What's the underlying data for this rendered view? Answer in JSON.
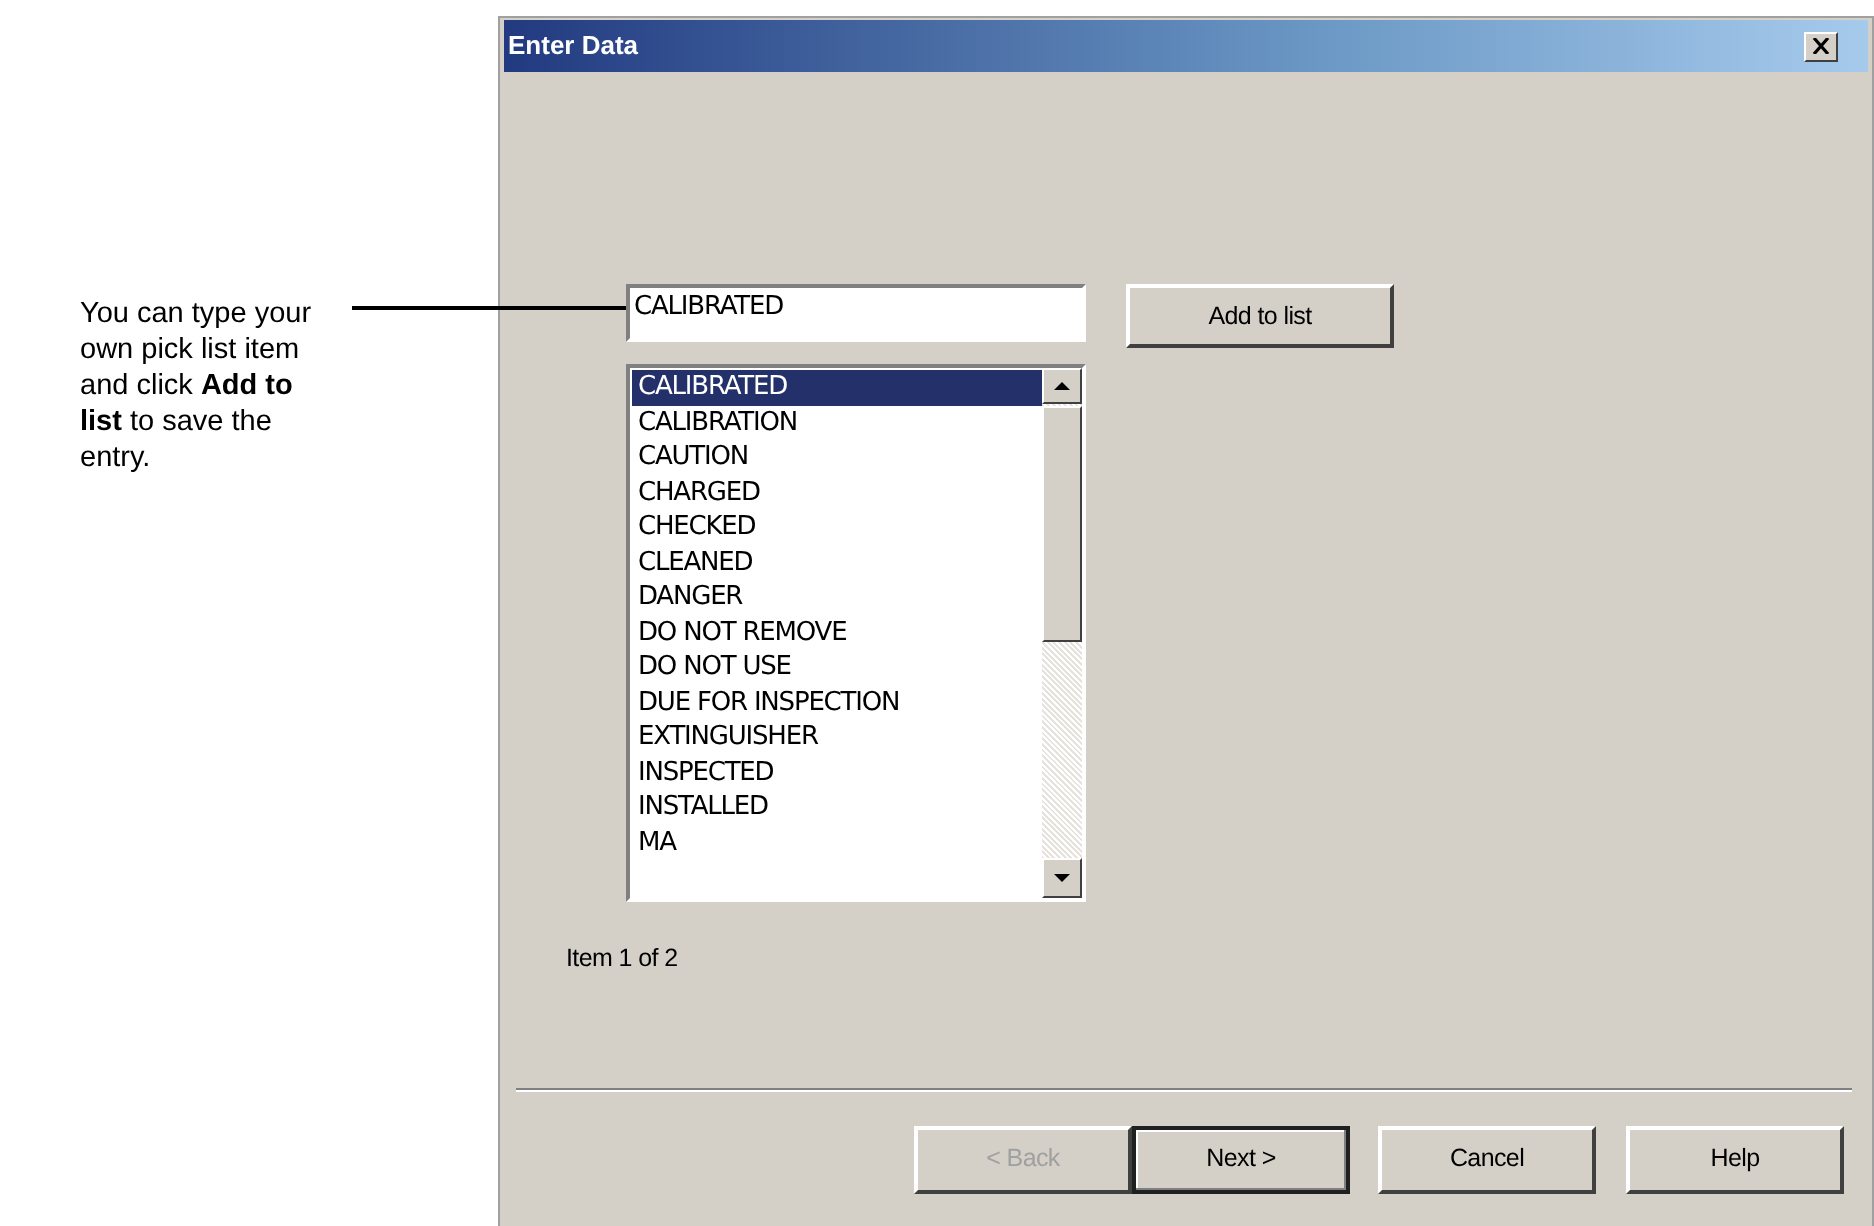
{
  "annotation": {
    "text": "You can type your own pick list item and click **Add to list** to save the entry."
  },
  "window": {
    "title": "Enter Data"
  },
  "entry_field": {
    "value": "CALIBRATED"
  },
  "add_button": {
    "label": "Add to list"
  },
  "pick_list": {
    "items": [
      {
        "label": "CALIBRATED",
        "selected": true
      },
      {
        "label": "CALIBRATION",
        "selected": false
      },
      {
        "label": "CAUTION",
        "selected": false
      },
      {
        "label": "CHARGED",
        "selected": false
      },
      {
        "label": "CHECKED",
        "selected": false
      },
      {
        "label": "CLEANED",
        "selected": false
      },
      {
        "label": "DANGER",
        "selected": false
      },
      {
        "label": "DO NOT REMOVE",
        "selected": false
      },
      {
        "label": "DO NOT USE",
        "selected": false
      },
      {
        "label": "DUE FOR INSPECTION",
        "selected": false
      },
      {
        "label": "EXTINGUISHER",
        "selected": false
      },
      {
        "label": "INSPECTED",
        "selected": false
      },
      {
        "label": "INSTALLED",
        "selected": false
      },
      {
        "label": "MA",
        "selected": false
      }
    ]
  },
  "status": "Item 1 of 2",
  "buttons": [
    {
      "label": "< Back",
      "disabled": true,
      "default": false
    },
    {
      "label": "Next >",
      "disabled": false,
      "default": true
    },
    {
      "label": "Cancel",
      "disabled": false,
      "default": false
    },
    {
      "label": "Help",
      "disabled": false,
      "default": false
    }
  ]
}
